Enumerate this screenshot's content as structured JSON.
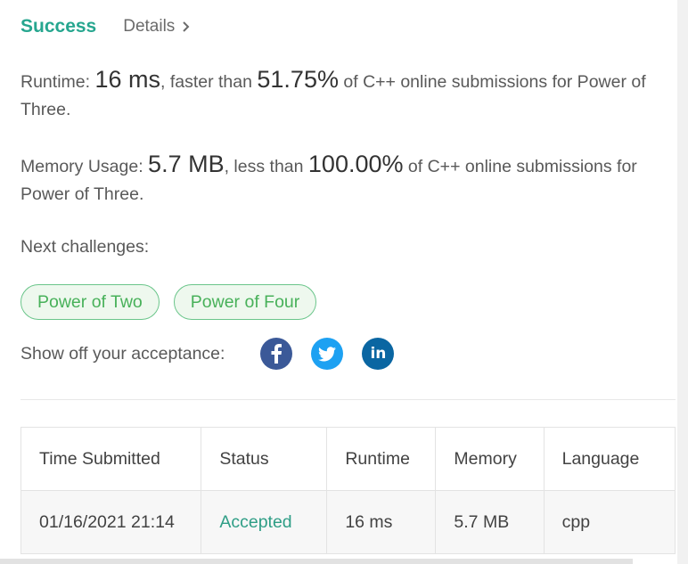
{
  "header": {
    "success_label": "Success",
    "details_label": "Details"
  },
  "runtime": {
    "label": "Runtime: ",
    "value": "16 ms",
    "middle": ", faster than ",
    "percent": "51.75%",
    "suffix": " of C++ online submissions for Power of Three."
  },
  "memory": {
    "label": "Memory Usage: ",
    "value": "5.7 MB",
    "middle": ", less than ",
    "percent": "100.00%",
    "suffix": " of C++ online submissions for Power of Three."
  },
  "next_challenges": {
    "label": "Next challenges:",
    "items": [
      "Power of Two",
      "Power of Four"
    ]
  },
  "share": {
    "label": "Show off your acceptance:",
    "icons": [
      "facebook-icon",
      "twitter-icon",
      "linkedin-icon"
    ],
    "linkedin_text": "in"
  },
  "table": {
    "headers": [
      "Time Submitted",
      "Status",
      "Runtime",
      "Memory",
      "Language"
    ],
    "rows": [
      [
        "01/16/2021 21:14",
        "Accepted",
        "16 ms",
        "5.7 MB",
        "cpp"
      ]
    ]
  },
  "colors": {
    "success": "#26a68f",
    "accepted": "#2f9e86",
    "chip_border": "#6ac58a",
    "chip_text": "#48b15a",
    "facebook": "#3b5998",
    "twitter": "#1da1f2",
    "linkedin": "#0a66a2"
  }
}
